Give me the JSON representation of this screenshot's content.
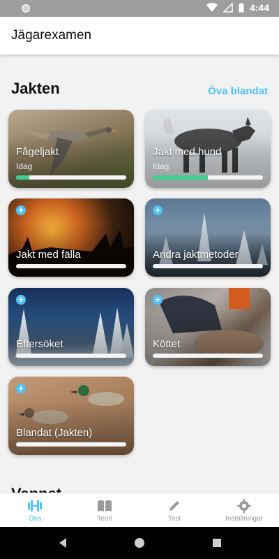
{
  "status_bar": {
    "time": "4:44"
  },
  "app_bar": {
    "title": "Jägarexamen"
  },
  "section": {
    "title": "Jakten",
    "practice_label": "Öva blandat"
  },
  "cards": [
    {
      "name": "Fågeljakt",
      "sub": "Idag",
      "progress": 0.12,
      "locked": false
    },
    {
      "name": "Jakt med hund",
      "sub": "Idag",
      "progress": 0.5,
      "locked": false
    },
    {
      "name": "Jakt med fälla",
      "sub": "",
      "progress": 0,
      "locked": true
    },
    {
      "name": "Andra jaktmetoder",
      "sub": "",
      "progress": 0,
      "locked": true
    },
    {
      "name": "Eftersöket",
      "sub": "",
      "progress": 0,
      "locked": true
    },
    {
      "name": "Köttet",
      "sub": "",
      "progress": 0,
      "locked": true
    },
    {
      "name": "Blandat (Jakten)",
      "sub": "",
      "progress": 0,
      "locked": true
    }
  ],
  "next_section": {
    "title": "Vapnet"
  },
  "bottom_nav": [
    {
      "label": "Öva",
      "icon": "dumbbell-icon",
      "active": true
    },
    {
      "label": "Teori",
      "icon": "book-icon",
      "active": false
    },
    {
      "label": "Test",
      "icon": "pencil-icon",
      "active": false
    },
    {
      "label": "Inställningar",
      "icon": "gear-icon",
      "active": false
    }
  ],
  "colors": {
    "accent": "#4fc3f7",
    "progress": "#3ccf8e"
  }
}
